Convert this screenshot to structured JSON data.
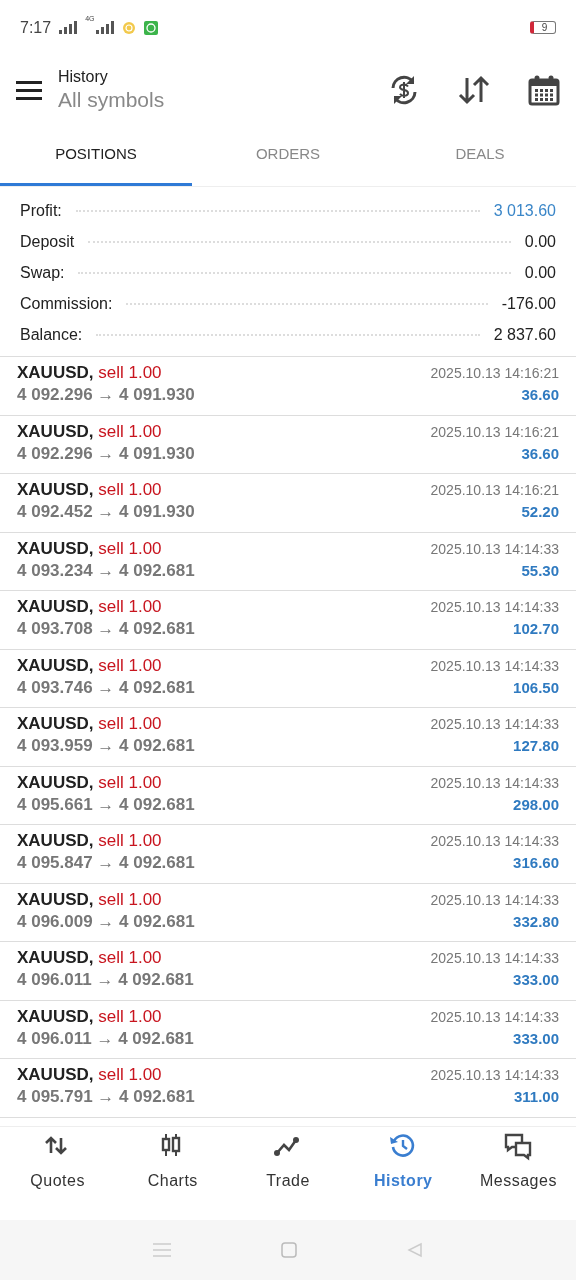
{
  "status_bar": {
    "time": "7:17",
    "network": "4G",
    "battery": "9"
  },
  "header": {
    "title": "History",
    "subtitle": "All symbols"
  },
  "tabs": [
    {
      "label": "POSITIONS",
      "selected": true
    },
    {
      "label": "ORDERS",
      "selected": false
    },
    {
      "label": "DEALS",
      "selected": false
    }
  ],
  "summary": [
    {
      "label": "Profit:",
      "value": "3 013.60",
      "color": "#3a86c8"
    },
    {
      "label": "Deposit",
      "value": "0.00",
      "color": "#212121"
    },
    {
      "label": "Swap:",
      "value": "0.00",
      "color": "#212121"
    },
    {
      "label": "Commission:",
      "value": "-176.00",
      "color": "#212121"
    },
    {
      "label": "Balance:",
      "value": "2 837.60",
      "color": "#212121"
    }
  ],
  "positions": [
    {
      "symbol": "XAUUSD,",
      "side": "sell 1.00",
      "prices": "4 092.296 → 4 091.930",
      "time": "2025.10.13 14:16:21",
      "profit": "36.60"
    },
    {
      "symbol": "XAUUSD,",
      "side": "sell 1.00",
      "prices": "4 092.296 → 4 091.930",
      "time": "2025.10.13 14:16:21",
      "profit": "36.60"
    },
    {
      "symbol": "XAUUSD,",
      "side": "sell 1.00",
      "prices": "4 092.452 → 4 091.930",
      "time": "2025.10.13 14:16:21",
      "profit": "52.20"
    },
    {
      "symbol": "XAUUSD,",
      "side": "sell 1.00",
      "prices": "4 093.234 → 4 092.681",
      "time": "2025.10.13 14:14:33",
      "profit": "55.30"
    },
    {
      "symbol": "XAUUSD,",
      "side": "sell 1.00",
      "prices": "4 093.708 → 4 092.681",
      "time": "2025.10.13 14:14:33",
      "profit": "102.70"
    },
    {
      "symbol": "XAUUSD,",
      "side": "sell 1.00",
      "prices": "4 093.746 → 4 092.681",
      "time": "2025.10.13 14:14:33",
      "profit": "106.50"
    },
    {
      "symbol": "XAUUSD,",
      "side": "sell 1.00",
      "prices": "4 093.959 → 4 092.681",
      "time": "2025.10.13 14:14:33",
      "profit": "127.80"
    },
    {
      "symbol": "XAUUSD,",
      "side": "sell 1.00",
      "prices": "4 095.661 → 4 092.681",
      "time": "2025.10.13 14:14:33",
      "profit": "298.00"
    },
    {
      "symbol": "XAUUSD,",
      "side": "sell 1.00",
      "prices": "4 095.847 → 4 092.681",
      "time": "2025.10.13 14:14:33",
      "profit": "316.60"
    },
    {
      "symbol": "XAUUSD,",
      "side": "sell 1.00",
      "prices": "4 096.009 → 4 092.681",
      "time": "2025.10.13 14:14:33",
      "profit": "332.80"
    },
    {
      "symbol": "XAUUSD,",
      "side": "sell 1.00",
      "prices": "4 096.011 → 4 092.681",
      "time": "2025.10.13 14:14:33",
      "profit": "333.00"
    },
    {
      "symbol": "XAUUSD,",
      "side": "sell 1.00",
      "prices": "4 096.011 → 4 092.681",
      "time": "2025.10.13 14:14:33",
      "profit": "333.00"
    },
    {
      "symbol": "XAUUSD,",
      "side": "sell 1.00",
      "prices": "4 095.791 → 4 092.681",
      "time": "2025.10.13 14:14:33",
      "profit": "311.00"
    }
  ],
  "bottom_nav": [
    {
      "label": "Quotes",
      "selected": false
    },
    {
      "label": "Charts",
      "selected": false
    },
    {
      "label": "Trade",
      "selected": false
    },
    {
      "label": "History",
      "selected": true
    },
    {
      "label": "Messages",
      "selected": false
    }
  ]
}
